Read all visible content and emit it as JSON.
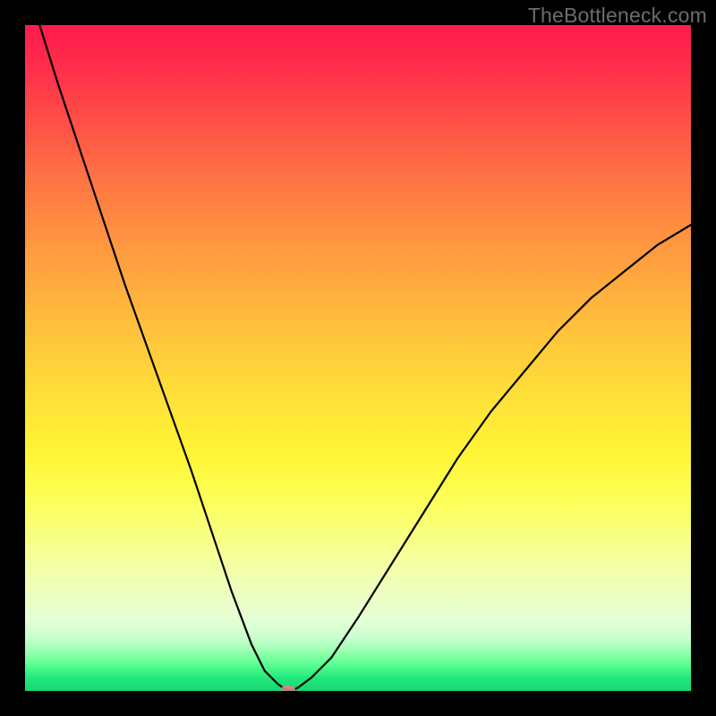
{
  "watermark": "TheBottleneck.com",
  "chart_data": {
    "type": "line",
    "title": "",
    "xlabel": "",
    "ylabel": "",
    "xlim": [
      0,
      100
    ],
    "ylim": [
      0,
      100
    ],
    "grid": false,
    "legend": false,
    "background_gradient": {
      "top": "#ff1a4d",
      "mid": "#ffe338",
      "bottom": "#18d873"
    },
    "series": [
      {
        "name": "bottleneck-curve",
        "x": [
          0,
          5,
          10,
          15,
          20,
          25,
          28,
          31,
          34,
          36,
          38,
          39,
          40,
          41,
          43,
          46,
          50,
          55,
          60,
          65,
          70,
          75,
          80,
          85,
          90,
          95,
          100
        ],
        "values": [
          107,
          91,
          76,
          61,
          47,
          33,
          24,
          15,
          7,
          3,
          1,
          0.3,
          0,
          0.5,
          2,
          5,
          11,
          19,
          27,
          35,
          42,
          48,
          54,
          59,
          63,
          67,
          70
        ]
      }
    ],
    "marker": {
      "x": 39.5,
      "y": 0,
      "color": "#d18a8a"
    },
    "notes": "Image has no visible axis ticks or labels; values are estimated relative to 0–100 in both axes. Curve minimum at x≈39.5."
  }
}
